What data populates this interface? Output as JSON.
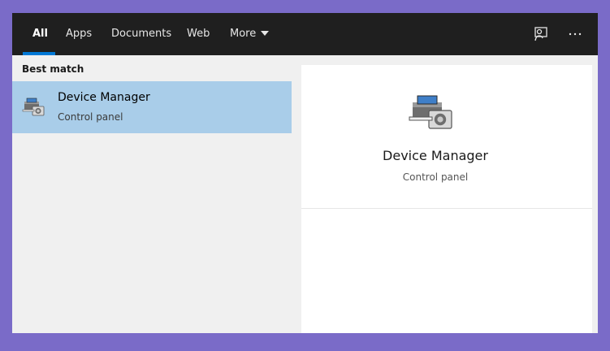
{
  "tabs": [
    {
      "label": "All",
      "active": true
    },
    {
      "label": "Apps",
      "active": false
    },
    {
      "label": "Documents",
      "active": false
    },
    {
      "label": "Web",
      "active": false
    },
    {
      "label": "More",
      "active": false
    }
  ],
  "topbar_icons": [
    "feedback-icon",
    "more-options-icon"
  ],
  "colors": {
    "background": "#7a6bc8",
    "topbar": "#1f1f1f",
    "accent": "#0078d4",
    "selection": "#a9cde9"
  },
  "left": {
    "section_header": "Best match",
    "result": {
      "title": "Device Manager",
      "subtitle": "Control panel",
      "icon": "device-manager-icon"
    }
  },
  "preview": {
    "title": "Device Manager",
    "subtitle": "Control panel",
    "icon": "device-manager-icon"
  }
}
